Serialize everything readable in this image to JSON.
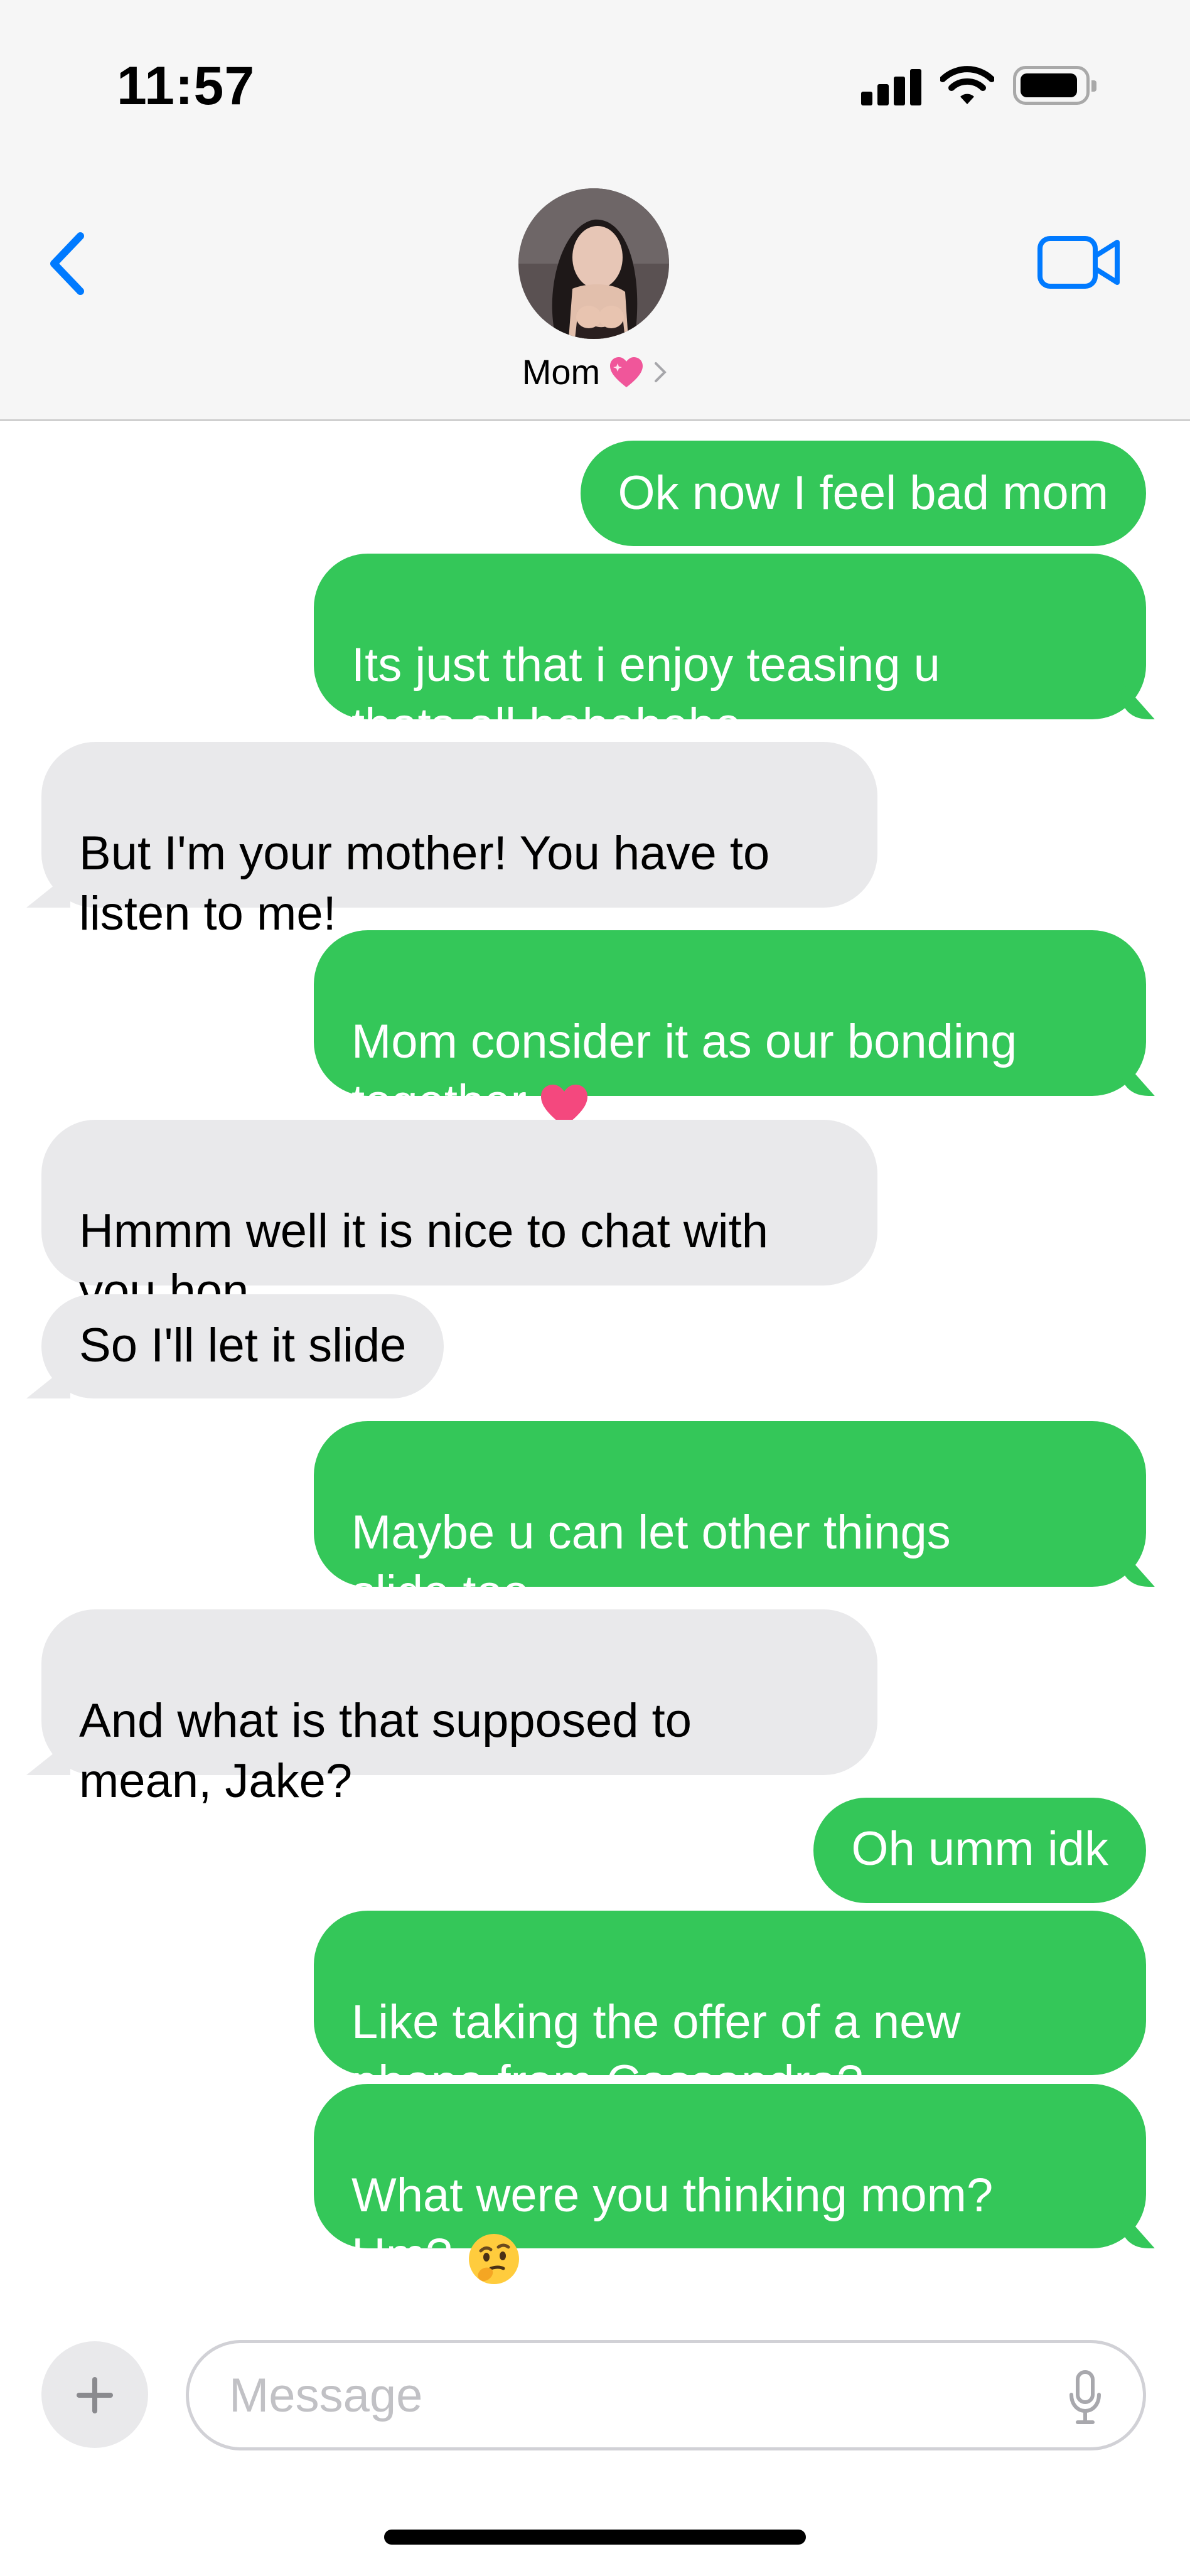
{
  "status_bar": {
    "time": "11:57"
  },
  "header": {
    "contact_name": "Mom"
  },
  "messages": [
    {
      "side": "sent",
      "text": "Ok now I feel bad mom"
    },
    {
      "side": "sent",
      "text": "Its just that i enjoy teasing u\nthats all hehehehe"
    },
    {
      "side": "received",
      "text": "But I'm your mother! You have to\nlisten to me!"
    },
    {
      "side": "sent",
      "text": "Mom consider it as our bonding\ntogether"
    },
    {
      "side": "received",
      "text": "Hmmm well it is nice to chat with\nyou hon"
    },
    {
      "side": "received",
      "text": "So I'll let it slide"
    },
    {
      "side": "sent",
      "text": "Maybe u can let other things\nslide too....."
    },
    {
      "side": "received",
      "text": "And what is that supposed to\nmean, Jake?"
    },
    {
      "side": "sent",
      "text": "Oh umm idk"
    },
    {
      "side": "sent",
      "text": "Like taking the offer of a new\nphone from Cassandra?"
    },
    {
      "side": "sent",
      "text": "What were you thinking mom?\nHm?"
    }
  ],
  "input": {
    "placeholder": "Message"
  },
  "icons": {
    "back": "chevron-left-icon",
    "video": "video-camera-icon",
    "plus": "plus-icon",
    "mic": "microphone-icon",
    "heart_after_name": "sparkling-heart-emoji",
    "heart_in_message": "heart-emoji",
    "face_in_message": "thinking-face-emoji"
  },
  "colors": {
    "sent": "#34c759",
    "received": "#e9e9eb",
    "accent": "#007aff"
  }
}
